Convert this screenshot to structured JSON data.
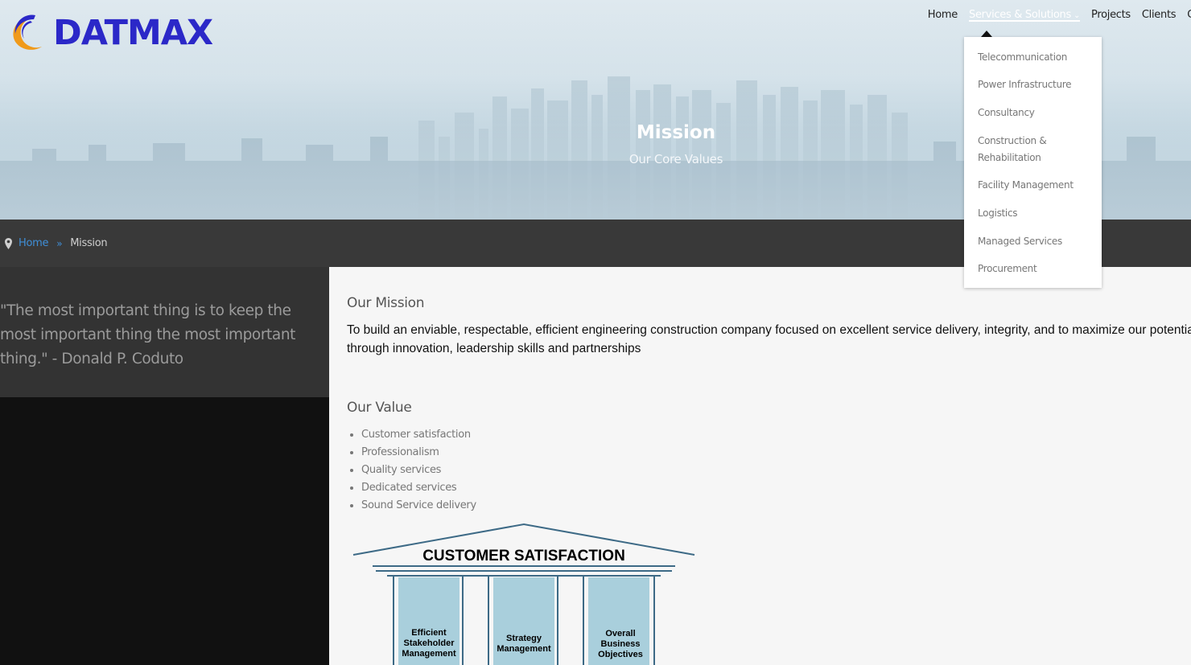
{
  "logo": {
    "text": "DATMAX"
  },
  "nav": {
    "items": [
      "Home",
      "Services & Solutions",
      "Projects",
      "Clients",
      "C"
    ],
    "active_index": 1
  },
  "hero": {
    "title": "Mission",
    "subtitle": "Our Core Values"
  },
  "breadcrumb": {
    "home": "Home",
    "current": "Mission"
  },
  "quote": "\"The most important thing is to keep the most important thing the most important thing.\" - Donald P. Coduto",
  "mission": {
    "heading": "Our Mission",
    "text": "To build an enviable, respectable, efficient engineering construction company focused on excellent service delivery, integrity, and to maximize our potential through innovation, leadership skills and partnerships"
  },
  "values": {
    "heading": "Our Value",
    "items": [
      "Customer satisfaction",
      "Professionalism",
      "Quality services",
      "Dedicated services",
      "Sound Service delivery"
    ]
  },
  "diagram": {
    "roof_label": "CUSTOMER SATISFACTION",
    "pillar1_lines": [
      "Efficient",
      "Stakeholder",
      "Management"
    ],
    "pillar2_lines": [
      "Strategy",
      "Management"
    ],
    "pillar3_lines": [
      "Overall",
      "Business",
      "Objectives"
    ]
  },
  "dropdown": {
    "items": [
      "Telecommunication",
      "Power Infrastructure",
      "Consultancy",
      "Construction & Rehabilitation",
      "Facility Management",
      "Logistics",
      "Managed Services",
      "Procurement"
    ]
  },
  "colors": {
    "logo_blue": "#2b28c8",
    "link_blue": "#3f8fd8",
    "crumb_bar": "#393939",
    "quote_panel": "#333333",
    "dark_panel": "#111111",
    "pillar_fill": "#a9cfdc"
  },
  "icons": {
    "logo": "crescent-logo-icon",
    "breadcrumb": "map-pin-icon",
    "separator": "double-chevron-right-icon",
    "nav_chevron": "chevron-down-icon"
  }
}
